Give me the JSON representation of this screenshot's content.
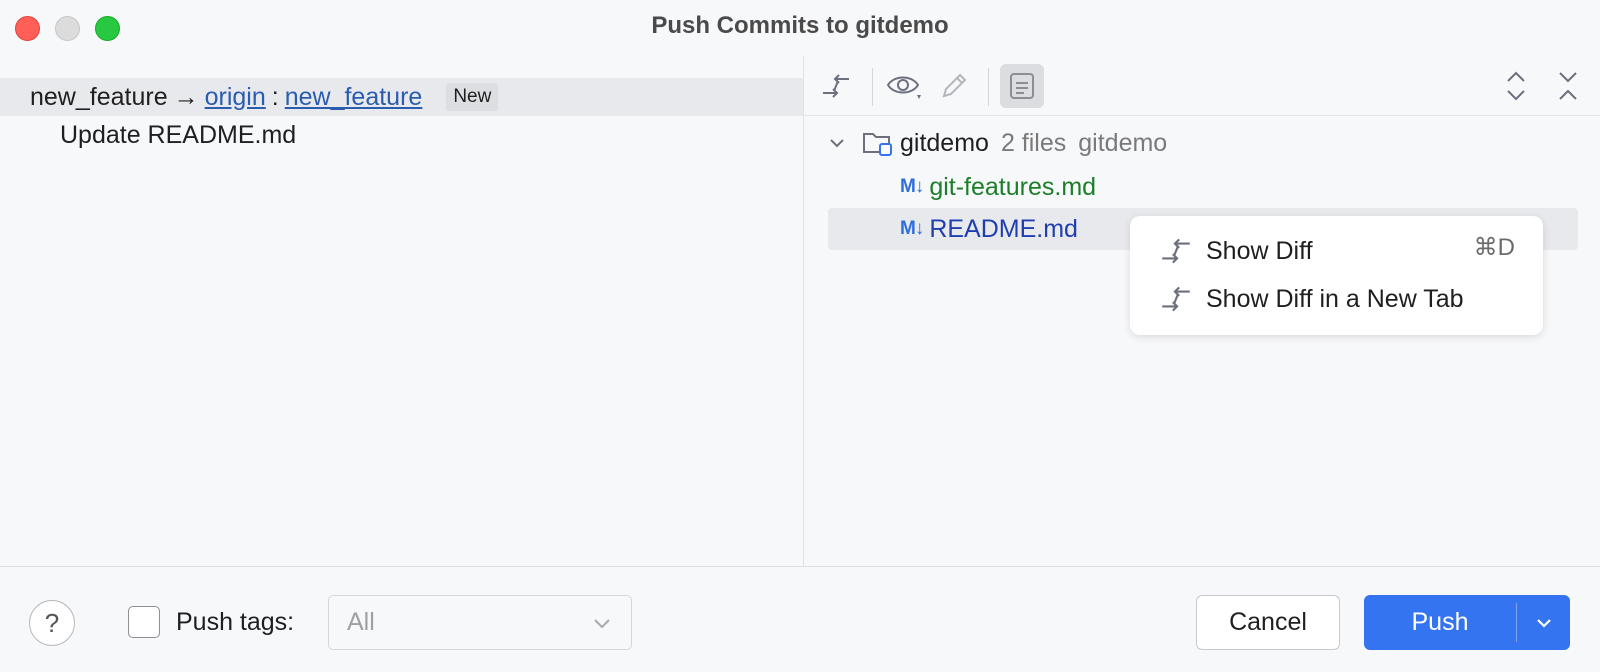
{
  "window": {
    "title": "Push Commits to gitdemo"
  },
  "left": {
    "branch": {
      "local": "new_feature",
      "arrow": "→",
      "remote": "origin",
      "separator": ":",
      "remote_branch": "new_feature",
      "badge": "New"
    },
    "commits": [
      {
        "message": "Update README.md"
      }
    ]
  },
  "toolbar": {
    "icons": [
      "show-diff-icon",
      "eye-icon",
      "edit-icon",
      "preview-icon",
      "expand-icon",
      "collapse-icon"
    ]
  },
  "tree": {
    "root": {
      "name": "gitdemo",
      "count": "2 files",
      "path": "gitdemo"
    },
    "files": [
      {
        "name": "git-features.md",
        "status_color": "#1d7e2a",
        "icon": "M↓"
      },
      {
        "name": "README.md",
        "status_color": "#1f3fae",
        "icon": "M↓"
      }
    ]
  },
  "context_menu": {
    "items": [
      {
        "label": "Show Diff",
        "shortcut": "⌘D"
      },
      {
        "label": "Show Diff in a New Tab",
        "shortcut": ""
      }
    ]
  },
  "footer": {
    "help": "?",
    "push_tags_label": "Push tags:",
    "push_tags_value": "All",
    "cancel_label": "Cancel",
    "push_label": "Push"
  },
  "colors": {
    "accent": "#3574f0",
    "link": "#2a5db0"
  }
}
